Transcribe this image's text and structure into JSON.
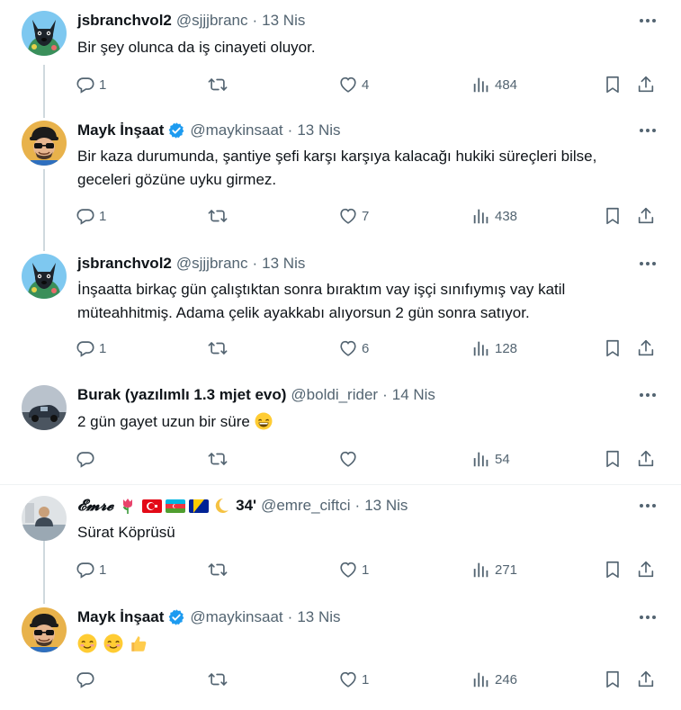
{
  "tweets": [
    {
      "name": "jsbranchvol2",
      "handle": "@sjjjbranc",
      "dot": "·",
      "time": "13 Nis",
      "text": "Bir şey olunca da iş cinayeti oluyor.",
      "replies": "1",
      "retweets": "",
      "likes": "4",
      "views": "484",
      "avatar": "dog-avatar"
    },
    {
      "name": "Mayk İnşaat",
      "handle": "@maykinsaat",
      "dot": "·",
      "time": "13 Nis",
      "text": "Bir kaza durumunda, şantiye şefi karşı karşıya kalacağı hukiki süreçleri bilse, geceleri gözüne uyku girmez.",
      "replies": "1",
      "retweets": "",
      "likes": "7",
      "views": "438",
      "avatar": "cartoon-avatar"
    },
    {
      "name": "jsbranchvol2",
      "handle": "@sjjjbranc",
      "dot": "·",
      "time": "13 Nis",
      "text": "İnşaatta birkaç gün çalıştıktan sonra bıraktım vay işçi sınıfıymış vay katil müteahhitmiş. Adama çelik ayakkabı alıyorsun 2 gün sonra satıyor.",
      "replies": "1",
      "retweets": "",
      "likes": "6",
      "views": "128",
      "avatar": "dog-avatar"
    },
    {
      "name": "Burak (yazılımlı 1.3 mjet evo)",
      "handle": "@boldi_rider",
      "dot": "·",
      "time": "14 Nis",
      "text": "2 gün gayet uzun bir süre",
      "replies": "",
      "retweets": "",
      "likes": "",
      "views": "54",
      "avatar": "car-avatar"
    },
    {
      "name": "𝓔𝓶𝓻𝓮",
      "name_suffix": "34'",
      "handle": "@emre_ciftci",
      "dot": "·",
      "time": "13 Nis",
      "text": "Sürat Köprüsü",
      "replies": "1",
      "retweets": "",
      "likes": "1",
      "views": "271",
      "avatar": "photo-avatar"
    },
    {
      "name": "Mayk İnşaat",
      "handle": "@maykinsaat",
      "dot": "·",
      "time": "13 Nis",
      "text": "",
      "replies": "",
      "retweets": "",
      "likes": "1",
      "views": "246",
      "avatar": "cartoon-avatar"
    }
  ],
  "colors": {
    "text": "#0f1419",
    "muted": "#536471",
    "verified": "#1d9bf0",
    "thread_line": "#cfd9de",
    "separator": "#eff3f4"
  },
  "icons": [
    "reply-icon",
    "retweet-icon",
    "like-icon",
    "views-icon",
    "bookmark-icon",
    "share-icon",
    "more-icon",
    "verified-badge-icon"
  ]
}
